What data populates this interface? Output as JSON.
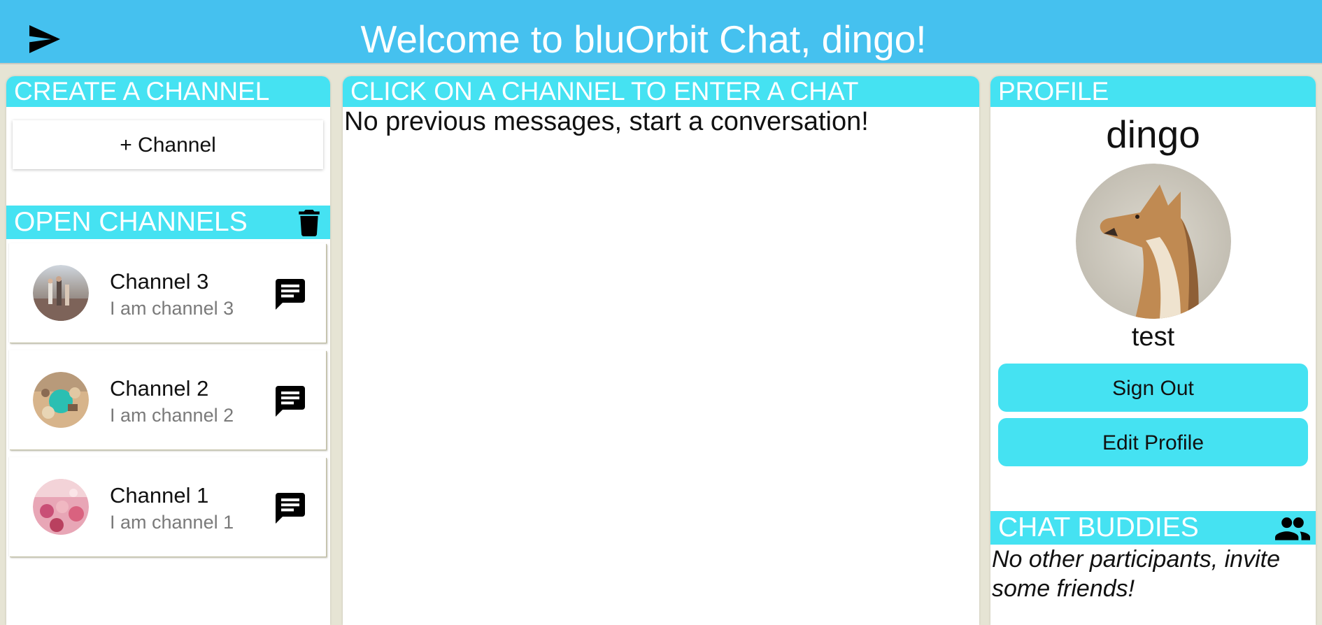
{
  "header": {
    "title": "Welcome to bluOrbit Chat, dingo!",
    "send_icon": "send-icon",
    "background": "#45c1ef"
  },
  "left_panel": {
    "create_header": "CREATE A CHANNEL",
    "add_channel_label": "+ Channel",
    "open_header": "OPEN CHANNELS",
    "trash_icon": "trash-icon",
    "channels": [
      {
        "name": "Channel 3",
        "description": "I am channel 3",
        "icon": "chat-icon"
      },
      {
        "name": "Channel 2",
        "description": "I am channel 2",
        "icon": "chat-icon"
      },
      {
        "name": "Channel 1",
        "description": "I am channel 1",
        "icon": "chat-icon"
      }
    ]
  },
  "chat_panel": {
    "header": "CLICK ON A CHANNEL TO ENTER A CHAT",
    "empty_message": "No previous messages, start a conversation!"
  },
  "profile_panel": {
    "header": "PROFILE",
    "username": "dingo",
    "status": "test",
    "sign_out_label": "Sign Out",
    "edit_profile_label": "Edit Profile",
    "buddies_header": "CHAT BUDDIES",
    "buddies_icon": "people-icon",
    "no_buddies_message": "No other participants, invite some friends!"
  },
  "colors": {
    "accent": "#45e2f2",
    "background": "#e6e4d4"
  }
}
